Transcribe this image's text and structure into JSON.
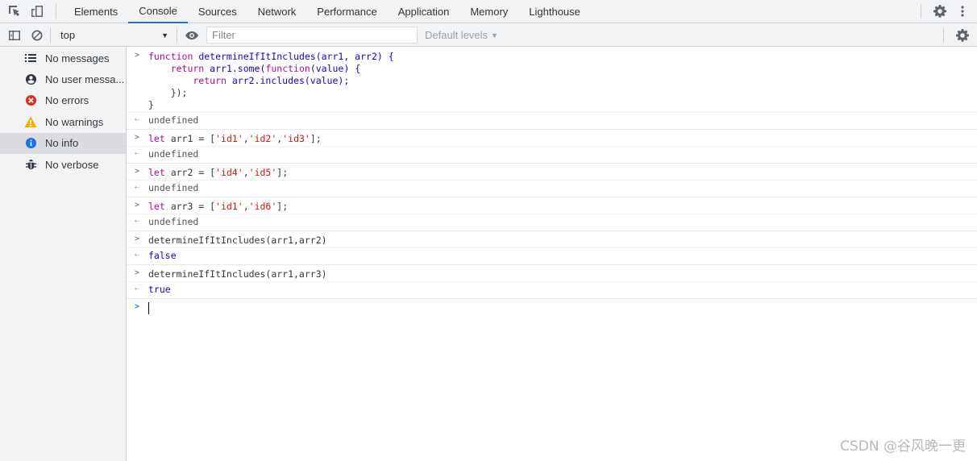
{
  "tabs": [
    {
      "label": "Elements"
    },
    {
      "label": "Console",
      "active": true
    },
    {
      "label": "Sources"
    },
    {
      "label": "Network"
    },
    {
      "label": "Performance"
    },
    {
      "label": "Application"
    },
    {
      "label": "Memory"
    },
    {
      "label": "Lighthouse"
    }
  ],
  "toolbar": {
    "context": "top",
    "filter_placeholder": "Filter",
    "levels": "Default levels"
  },
  "sidebar": {
    "items": [
      {
        "label": "No messages",
        "icon": "list-icon"
      },
      {
        "label": "No user messa...",
        "icon": "user-icon"
      },
      {
        "label": "No errors",
        "icon": "error-icon",
        "color": "#d93025"
      },
      {
        "label": "No warnings",
        "icon": "warning-icon",
        "color": "#f9ab00"
      },
      {
        "label": "No info",
        "icon": "info-icon",
        "color": "#1a73e8",
        "selected": true
      },
      {
        "label": "No verbose",
        "icon": "bug-icon"
      }
    ]
  },
  "console": {
    "fn_def": {
      "l1a": "function",
      "l1b": " determineIfItIncludes(arr1, arr2) {",
      "l2a": "    return",
      "l2b": " arr1.some(",
      "l2c": "function",
      "l2d": "(value) {",
      "l3a": "        return",
      "l3b": " arr2.includes(value);",
      "l4": "    });",
      "l5": "}"
    },
    "undefined_text": "undefined",
    "arr1": {
      "kw": "let",
      "pre": " arr1 = [",
      "s1": "'id1'",
      "s2": "'id2'",
      "s3": "'id3'",
      "post": "];"
    },
    "arr2": {
      "kw": "let",
      "pre": " arr2 = [",
      "s1": "'id4'",
      "s2": "'id5'",
      "post": "];"
    },
    "arr3": {
      "kw": "let",
      "pre": " arr3 = [",
      "s1": "'id1'",
      "s2": "'id6'",
      "post": "];"
    },
    "call1": "determineIfItIncludes(arr1,arr2)",
    "result1": "false",
    "call2": "determineIfItIncludes(arr1,arr3)",
    "result2": "true",
    "comma": ","
  },
  "watermark": "CSDN @谷风晚一更"
}
